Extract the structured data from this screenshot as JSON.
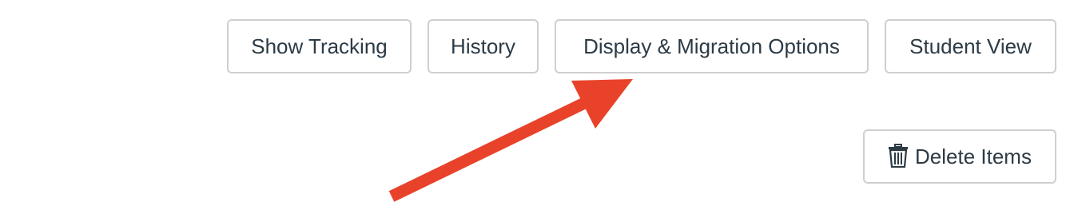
{
  "toolbar": {
    "show_tracking": "Show Tracking",
    "history": "History",
    "display_migration": "Display & Migration Options",
    "student_view": "Student View"
  },
  "actions": {
    "delete_items": "Delete Items",
    "delete_icon": "trash-icon"
  },
  "annotation": {
    "arrow_color": "#e8432a",
    "arrow_icon": "arrow-pointing-icon"
  },
  "colors": {
    "button_border": "#cfcfcf",
    "button_text": "#2d3b45",
    "background": "#ffffff"
  }
}
